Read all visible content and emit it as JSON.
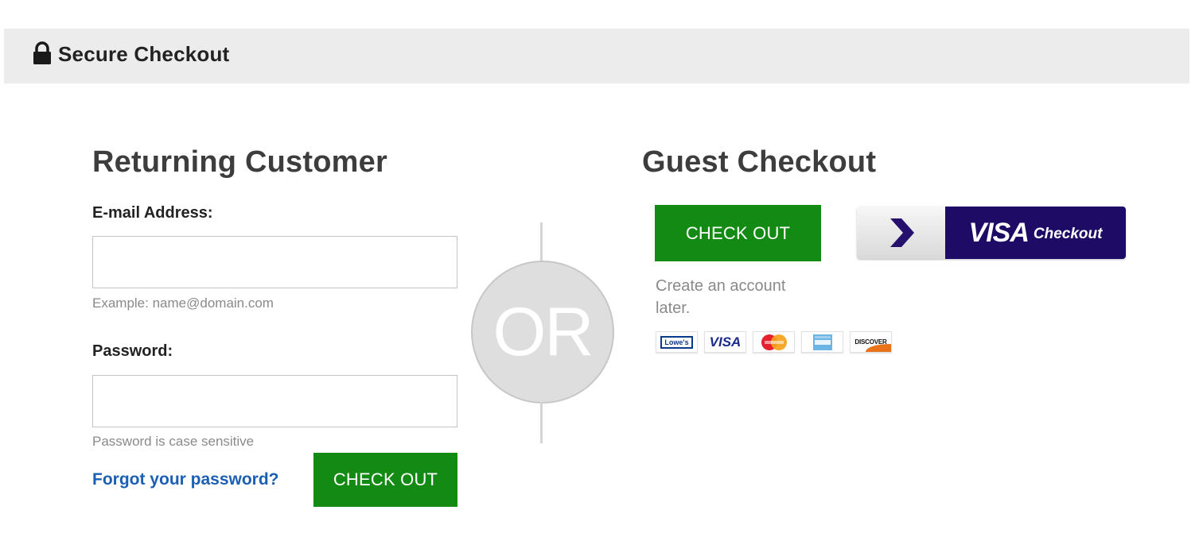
{
  "header": {
    "title": "Secure Checkout",
    "lock_icon": "lock-icon"
  },
  "returning": {
    "title": "Returning Customer",
    "email_label": "E-mail Address:",
    "email_value": "",
    "email_hint": "Example: name@domain.com",
    "password_label": "Password:",
    "password_value": "",
    "password_hint": "Password is case sensitive",
    "forgot_link": "Forgot your password?",
    "checkout_button": "CHECK OUT"
  },
  "divider": {
    "text": "OR"
  },
  "guest": {
    "title": "Guest Checkout",
    "checkout_button": "CHECK OUT",
    "note": "Create an account later.",
    "visa_checkout": {
      "brand": "VISA",
      "label": "Checkout"
    },
    "payment_cards": [
      {
        "name": "lowes",
        "label": "Lowe's"
      },
      {
        "name": "visa",
        "label": "VISA"
      },
      {
        "name": "mastercard",
        "label": ""
      },
      {
        "name": "amex",
        "label": ""
      },
      {
        "name": "discover",
        "label": "DISCOVER"
      }
    ]
  },
  "colors": {
    "header_bg": "#ececec",
    "button_green": "#138a13",
    "link_blue": "#1a5fb4",
    "visa_navy": "#1d0b66",
    "visa_arrow": "#26106e",
    "or_circle": "#dedede"
  }
}
